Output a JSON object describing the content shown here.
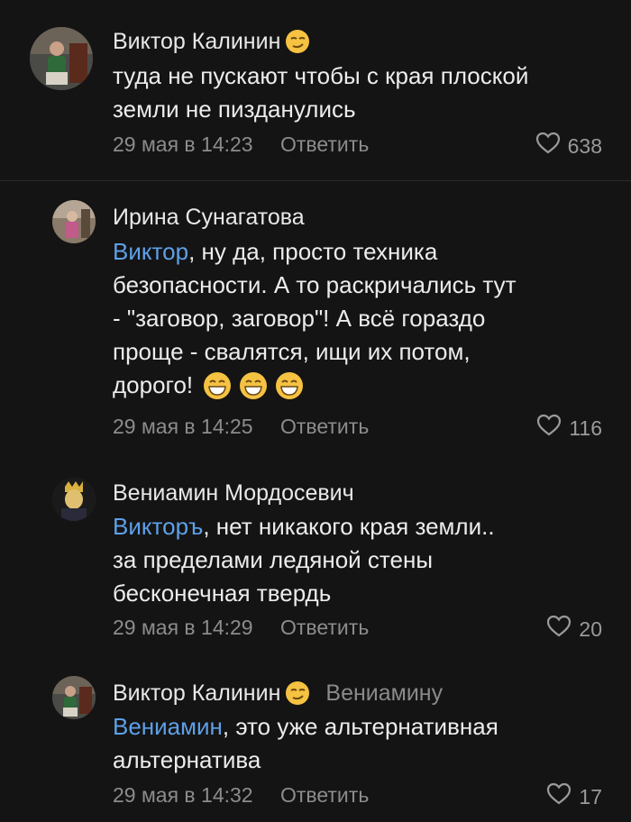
{
  "comments": [
    {
      "author": "Виктор Калинин",
      "reply_to": "",
      "mention": "",
      "text_lines": [
        "туда не пускают чтобы с края плоской",
        "земли не пизданулись"
      ],
      "date": "29 мая в 14:23",
      "reply_label": "Ответить",
      "likes": "638"
    },
    {
      "author": "Ирина Сунагатова",
      "reply_to": "",
      "mention": "Виктор",
      "text_lines": [
        ", ну да, просто техника",
        "безопасности. А то раскричались тут",
        "- \"заговор, заговор\"! А всё гораздо",
        "проще - свалятся, ищи их потом,",
        "дорого!"
      ],
      "date": "29 мая в 14:25",
      "reply_label": "Ответить",
      "likes": "116"
    },
    {
      "author": "Вениамин Мордосевич",
      "reply_to": "",
      "mention": "Викторъ",
      "text_lines": [
        ", нет никакого края земли..",
        "за пределами ледяной стены",
        "бесконечная твердь"
      ],
      "date": "29 мая в 14:29",
      "reply_label": "Ответить",
      "likes": "20"
    },
    {
      "author": "Виктор Калинин",
      "reply_to": "Вениамину",
      "mention": "Вениамин",
      "text_lines": [
        ", это уже альтернативная",
        "альтернатива"
      ],
      "date": "29 мая в 14:32",
      "reply_label": "Ответить",
      "likes": "17"
    }
  ],
  "icons": {
    "like": "heart-outline-icon",
    "smirk": "smirk-emoji-icon",
    "grin": "grin-emoji-icon"
  },
  "colors": {
    "background": "#141414",
    "mention": "#5ea0e8",
    "meta": "#8c8c8c",
    "emoji": "#f5c242"
  }
}
